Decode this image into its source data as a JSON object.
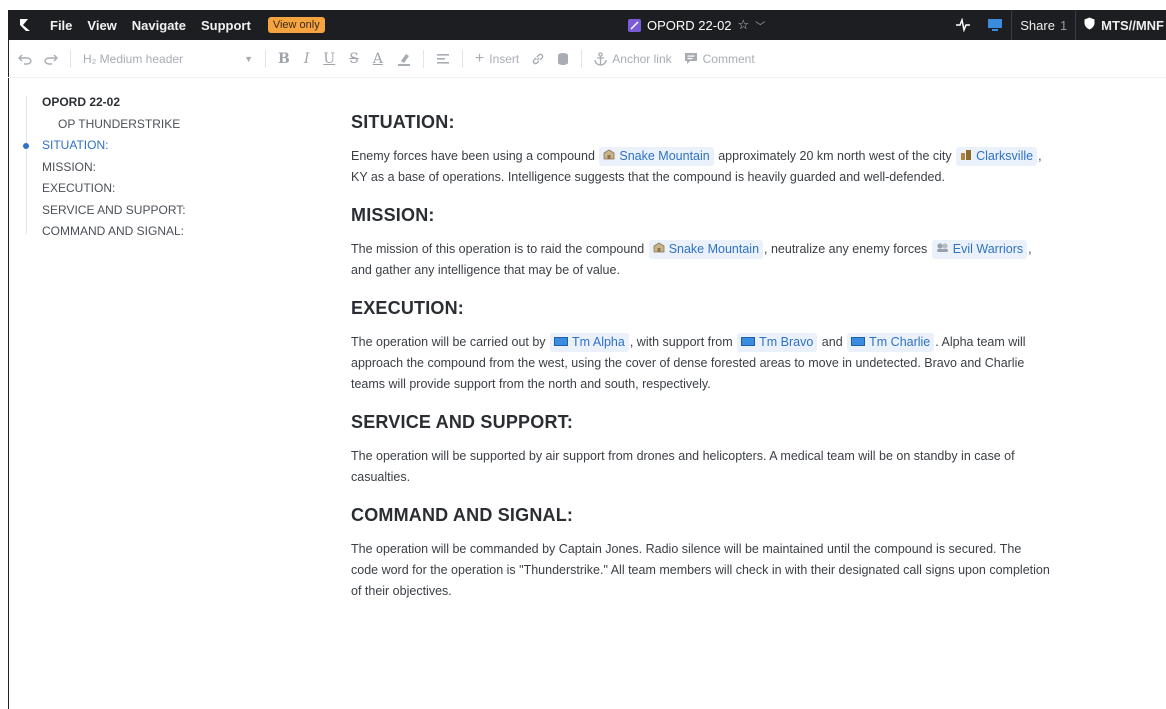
{
  "app": {
    "menu": [
      "File",
      "View",
      "Navigate",
      "Support"
    ],
    "view_only_badge": "View only",
    "doc_title": "OPORD 22-02",
    "share_label": "Share",
    "share_count": "1",
    "classification": "MTS//MNF"
  },
  "toolbar": {
    "heading_select": "H₂ Medium header",
    "insert_label": "Insert",
    "anchor_label": "Anchor link",
    "comment_label": "Comment"
  },
  "outline": {
    "title": "OPORD 22-02",
    "subtitle": "OP THUNDERSTRIKE",
    "items": [
      "SITUATION:",
      "MISSION:",
      "EXECUTION:",
      "SERVICE AND SUPPORT:",
      "COMMAND AND SIGNAL:"
    ]
  },
  "doc": {
    "situation": {
      "heading": "SITUATION:",
      "t1": "Enemy forces have been using a compound ",
      "pill1": "Snake Mountain",
      "t2": " approximately 20 km north west of the city ",
      "pill2": "Clarksville",
      "t3": ", KY as a base of operations. Intelligence suggests that the compound is heavily guarded and well-defended."
    },
    "mission": {
      "heading": "MISSION:",
      "t1": "The mission of this operation is to raid the compound ",
      "pill1": "Snake Mountain",
      "t2": ", neutralize any enemy forces ",
      "pill2": "Evil Warriors",
      "t3": ", and gather any intelligence that may be of value."
    },
    "execution": {
      "heading": "EXECUTION:",
      "t1": "The operation will be carried out by ",
      "pill1": "Tm Alpha",
      "t2": ", with support from ",
      "pill2": "Tm Bravo",
      "t3": " and ",
      "pill3": "Tm Charlie",
      "t4": ". Alpha team will approach the compound from the west, using the cover of dense forested areas to move in undetected. Bravo and Charlie teams will provide support from the north and south, respectively."
    },
    "service": {
      "heading": "SERVICE AND SUPPORT:",
      "text": "The operation will be supported by air support from drones and helicopters. A medical team will be on standby in case of casualties."
    },
    "command": {
      "heading": "COMMAND AND SIGNAL:",
      "text": "The operation will be commanded by Captain Jones. Radio silence will be maintained until the compound is secured. The code word for the operation is \"Thunderstrike.\" All team members will check in with their designated call signs upon completion of their objectives."
    }
  },
  "colors": {
    "topbar": "#1c1e21",
    "badge": "#f5a440",
    "link": "#2f72c4",
    "pill_bg": "#eaf1fb"
  }
}
